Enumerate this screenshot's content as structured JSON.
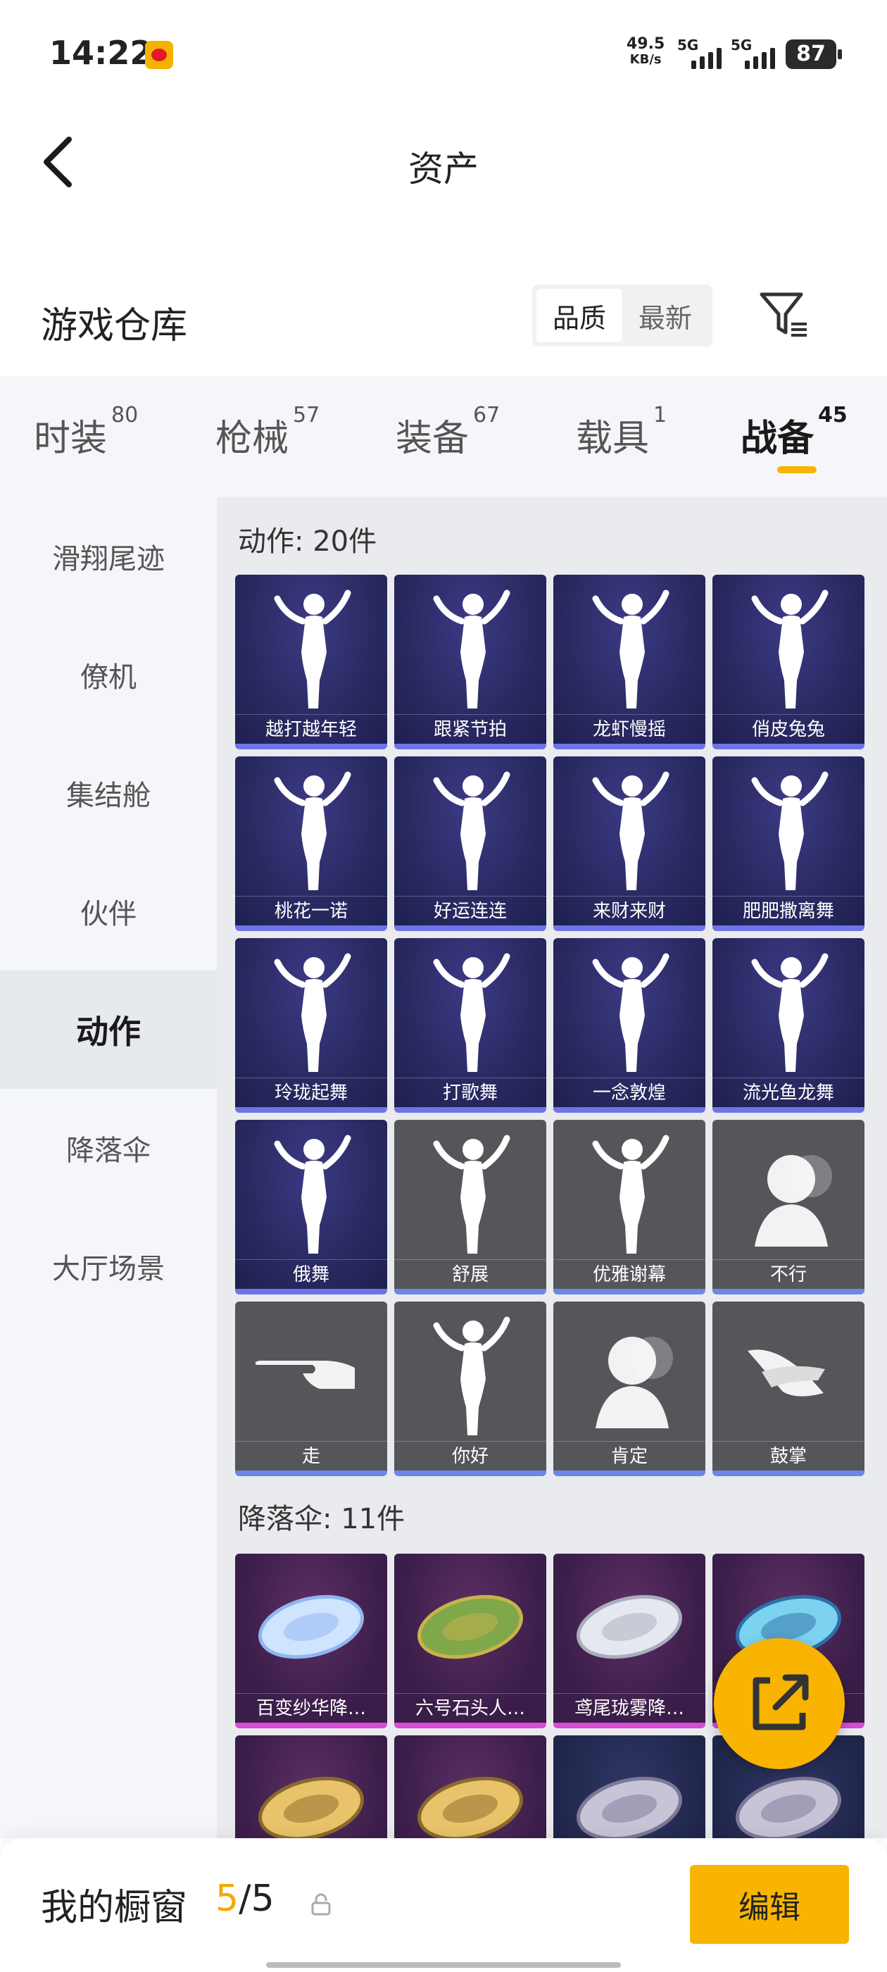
{
  "status_bar": {
    "time": "14:22",
    "speed_value": "49.5",
    "speed_unit": "KB/s",
    "net1": "5G",
    "net2": "5G",
    "battery": "87"
  },
  "header": {
    "title": "资产",
    "back_icon": "back-chevron"
  },
  "section": {
    "title": "游戏仓库",
    "sort_options": [
      "品质",
      "最新"
    ],
    "active_sort": "品质",
    "filter_icon": "filter-funnel"
  },
  "tabs": [
    {
      "label": "时装",
      "count": "80"
    },
    {
      "label": "枪械",
      "count": "57"
    },
    {
      "label": "装备",
      "count": "67"
    },
    {
      "label": "载具",
      "count": "1"
    },
    {
      "label": "战备",
      "count": "45"
    }
  ],
  "active_tab": "战备",
  "sidebar": {
    "items": [
      "滑翔尾迹",
      "僚机",
      "集结舱",
      "伙伴",
      "动作",
      "降落伞",
      "大厅场景"
    ],
    "active": "动作"
  },
  "groups": [
    {
      "label": "动作: 20件",
      "items": [
        {
          "name": "越打越年轻",
          "style": "purple",
          "art": "dance-silhouette"
        },
        {
          "name": "跟紧节拍",
          "style": "purple",
          "art": "dance-silhouette"
        },
        {
          "name": "龙虾慢摇",
          "style": "purple",
          "art": "dance-silhouette"
        },
        {
          "name": "俏皮兔兔",
          "style": "purple",
          "art": "dance-silhouette"
        },
        {
          "name": "桃花一诺",
          "style": "purple",
          "art": "butterfly-silhouette"
        },
        {
          "name": "好运连连",
          "style": "purple",
          "art": "lucky-silhouette"
        },
        {
          "name": "来财来财",
          "style": "purple",
          "art": "fortune-silhouette"
        },
        {
          "name": "肥肥撒离舞",
          "style": "purple",
          "art": "firework-silhouette"
        },
        {
          "name": "玲珑起舞",
          "style": "purple",
          "art": "dance-silhouette"
        },
        {
          "name": "打歌舞",
          "style": "purple",
          "art": "stage-silhouette"
        },
        {
          "name": "一念敦煌",
          "style": "purple",
          "art": "dance-silhouette"
        },
        {
          "name": "流光鱼龙舞",
          "style": "purple",
          "art": "firework-silhouette"
        },
        {
          "name": "俄舞",
          "style": "purple",
          "art": "dance-silhouette"
        },
        {
          "name": "舒展",
          "style": "grey",
          "art": "stretch-silhouette"
        },
        {
          "name": "优雅谢幕",
          "style": "grey",
          "art": "bow-silhouette"
        },
        {
          "name": "不行",
          "style": "grey",
          "art": "head-shake-silhouette"
        },
        {
          "name": "走",
          "style": "grey",
          "art": "pointing-hand"
        },
        {
          "name": "你好",
          "style": "grey",
          "art": "waving-silhouette"
        },
        {
          "name": "肯定",
          "style": "grey",
          "art": "nod-silhouette"
        },
        {
          "name": "鼓掌",
          "style": "grey",
          "art": "clapping-hands"
        }
      ]
    },
    {
      "label": "降落伞: 11件",
      "items": [
        {
          "name": "百变纱华降…",
          "style": "magenta",
          "art": "parachute-ice"
        },
        {
          "name": "六号石头人…",
          "style": "magenta",
          "art": "parachute-camo"
        },
        {
          "name": "鸢尾珑雾降…",
          "style": "magenta",
          "art": "parachute-silver"
        },
        {
          "name": "",
          "style": "magenta",
          "art": "parachute-crystal"
        },
        {
          "name": "",
          "style": "magenta",
          "art": "parachute-gold"
        },
        {
          "name": "",
          "style": "magenta",
          "art": "parachute-gold"
        },
        {
          "name": "",
          "style": "navy",
          "art": "parachute-round"
        },
        {
          "name": "",
          "style": "navy",
          "art": "parachute-round"
        }
      ]
    }
  ],
  "bottom_bar": {
    "label": "我的橱窗",
    "current": "5",
    "separator": "/",
    "total": "5",
    "edit_label": "编辑"
  },
  "colors": {
    "accent": "#f8b400",
    "purple_rarity": "#6e74e8",
    "magenta_rarity": "#d94bd6"
  }
}
